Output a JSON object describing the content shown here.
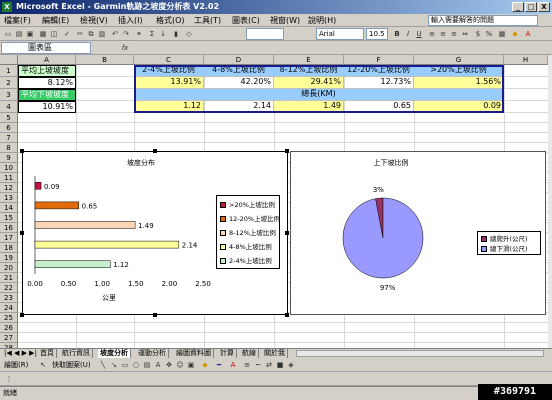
{
  "window": {
    "title": "Microsoft Excel - Garmin軌跡之坡度分析表 V2.02",
    "controls": [
      "_",
      "□",
      "X"
    ]
  },
  "menu": {
    "items": [
      "檔案(F)",
      "編輯(E)",
      "檢視(V)",
      "插入(I)",
      "格式(O)",
      "工具(T)",
      "圖表(C)",
      "視窗(W)",
      "說明(H)"
    ],
    "help_placeholder": "輸入需要解答的問題"
  },
  "toolbar": {
    "font_name": "Arial",
    "font_size": "10.5"
  },
  "namebox": {
    "value": "圖表區"
  },
  "columns": [
    "A",
    "B",
    "C",
    "D",
    "E",
    "F",
    "G",
    "H"
  ],
  "rows": [
    "1",
    "2",
    "3",
    "4",
    "5",
    "6",
    "7",
    "8",
    "9",
    "10",
    "11",
    "12",
    "13",
    "14",
    "15",
    "16",
    "17",
    "18",
    "19",
    "20",
    "21",
    "22",
    "23",
    "24",
    "25",
    "26",
    "27",
    "28",
    "29",
    "30"
  ],
  "cells": {
    "A1": "平均上坡坡度",
    "A2": "8.12%",
    "A3": "平均下坡坡度",
    "A4": "10.91%",
    "C1": "2-4%上坡比例",
    "D1": "4-8%上坡比例",
    "E1": "8-12%上坡比例",
    "F1": "12-20%上坡比例",
    "G1": ">20%上坡比例",
    "C2": "13.91%",
    "D2": "42.20%",
    "E2": "29.41%",
    "F2": "12.73%",
    "G2": "1.56%",
    "C3": "總長(KM)",
    "C4": "1.12",
    "D4": "2.14",
    "E4": "1.49",
    "F4": "0.65",
    "G4": "0.09"
  },
  "chart_data": [
    {
      "type": "bar",
      "title": "坡度分布",
      "xlabel": "公里",
      "categories": [
        "2-4%上坡比例",
        "4-8%上坡比例",
        "8-12%上坡比例",
        "12-20%上坡比例",
        ">20%上坡比例"
      ],
      "values": [
        1.12,
        2.14,
        1.49,
        0.65,
        0.09
      ],
      "colors": [
        "#c6efce",
        "#ffff99",
        "#fcd5b4",
        "#e26b0a",
        "#c0143c"
      ],
      "xlim": [
        0,
        2.5
      ],
      "xticks": [
        "0.00",
        "0.50",
        "1.00",
        "1.50",
        "2.00",
        "2.50"
      ],
      "legend_position": "right"
    },
    {
      "type": "pie",
      "title": "上下坡比例",
      "labels": [
        "總爬升(公尺)",
        "總下滑(公尺)"
      ],
      "values": [
        3,
        97
      ],
      "value_labels": [
        "3%",
        "97%"
      ],
      "colors": [
        "#993366",
        "#9999ff"
      ],
      "legend_position": "right"
    }
  ],
  "sheet_tabs": [
    "首頁",
    "航行資訊",
    "坡度分析",
    "運動分析",
    "繪圖資料圖",
    "計算",
    "航線",
    "關於我"
  ],
  "active_tab": "坡度分析",
  "drawbar": {
    "draw_label": "繪圖(R)",
    "autoshape_label": "快取圖案(U)"
  },
  "status": {
    "text": "就緒"
  },
  "watermark": "#369791"
}
